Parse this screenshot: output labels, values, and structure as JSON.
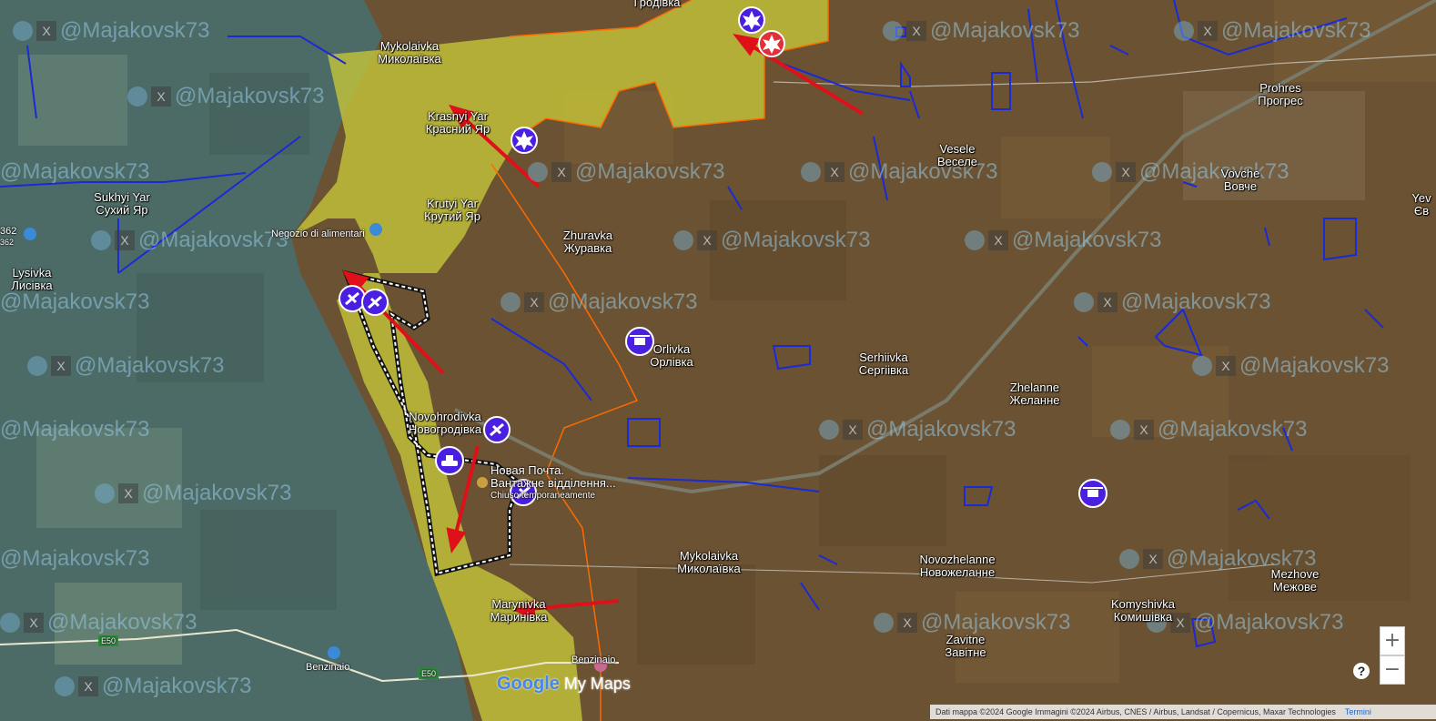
{
  "places": [
    {
      "id": "hrodivka",
      "name": "Гродівка"
    },
    {
      "id": "mykolaivka_n",
      "name": "Mykolaivka",
      "local": "Миколаївка"
    },
    {
      "id": "krasnyi_yar",
      "name": "Krasnyi Yar",
      "local": "Красний Яр"
    },
    {
      "id": "sukhyi_yar",
      "name": "Sukhyi Yar",
      "local": "Сухий Яр"
    },
    {
      "id": "krutyi_yar",
      "name": "Krutyi Yar",
      "local": "Крутий Яр"
    },
    {
      "id": "lysivka",
      "name": "Lysivka",
      "local": "Лисівка"
    },
    {
      "id": "zhuravka",
      "name": "Zhuravka",
      "local": "Журавка"
    },
    {
      "id": "orlivka",
      "name": "Orlivka",
      "local": "Орлівка"
    },
    {
      "id": "veselo",
      "name": "Vesele",
      "local": "Веселе"
    },
    {
      "id": "prohres",
      "name": "Prohres",
      "local": "Прогрес"
    },
    {
      "id": "vovche",
      "name": "Vovche",
      "local": "Вовче"
    },
    {
      "id": "yev",
      "name": "Yev",
      "local": "Єв"
    },
    {
      "id": "serhiivka",
      "name": "Serhiivka",
      "local": "Сергіівка"
    },
    {
      "id": "zhelanne",
      "name": "Zhelanne",
      "local": "Желанне"
    },
    {
      "id": "novohrodivka",
      "name": "Novohrodivka",
      "local": "Новогродівка"
    },
    {
      "id": "mykolaivka_s",
      "name": "Mykolaivka",
      "local": "Миколаївка"
    },
    {
      "id": "novozhelanne",
      "name": "Novozhelanne",
      "local": "Новожеланне"
    },
    {
      "id": "mezhove",
      "name": "Mezhove",
      "local": "Межове"
    },
    {
      "id": "komyshivka",
      "name": "Komyshivka",
      "local": "Комишівка"
    },
    {
      "id": "zavitne",
      "name": "Zavitne",
      "local": "Завітне"
    },
    {
      "id": "marynivka",
      "name": "Marynivka",
      "local": "Маринівка"
    }
  ],
  "pois": {
    "negozio": "Negozio di alimentari",
    "nova_poshta_1": "Новая Почта.",
    "nova_poshta_2": "Вантажне відділення...",
    "nova_poshta_3": "Chiuso temporaneamente",
    "benzinaio_1": "Benzinaio",
    "benzinaio_2": "Benzinaio",
    "num_362a": "362",
    "num_362b": "362",
    "road_e50a": "E50",
    "road_e50b": "E50"
  },
  "watermark": {
    "handle": "@Majakovsk73",
    "x_glyph": "X"
  },
  "map_controls": {
    "zoom_in": "+",
    "zoom_out": "−",
    "help": "?"
  },
  "logo": {
    "google": "Google",
    "mymaps": " My Maps"
  },
  "attribution": {
    "text": "Dati mappa ©2024 Google Immagini ©2024 Airbus, CNES / Airbus, Landsat / Copernicus, Maxar Technologies",
    "terms": "Termini"
  },
  "colors": {
    "occupied_zone": "#6b5232",
    "contested_zone": "#c8c83a",
    "ukr_zone": "#4a6e6a",
    "front_line_orange": "#ff6a00",
    "trench_blue": "#1a2ad6",
    "arrow_red": "#e0101a",
    "marker_purple": "#4b1fe0"
  }
}
